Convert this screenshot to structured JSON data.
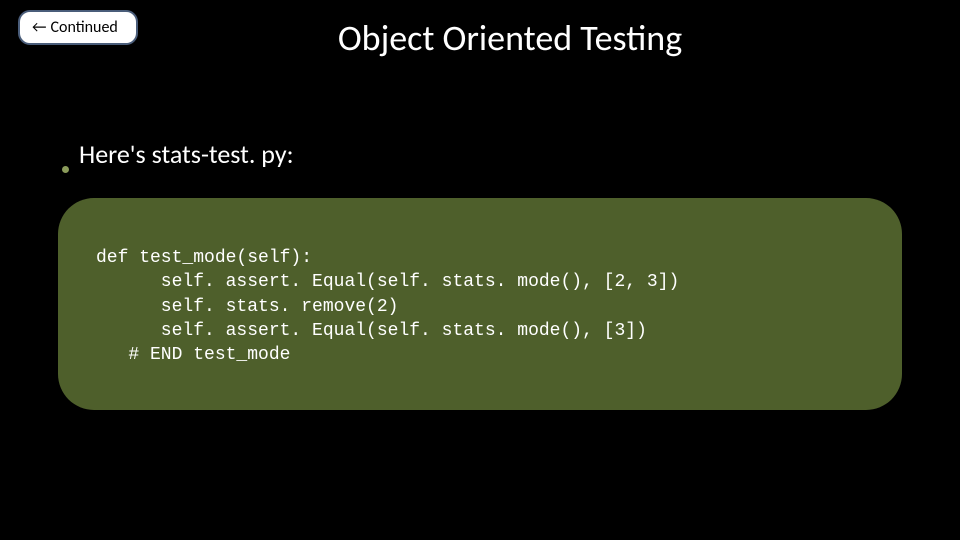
{
  "badge": {
    "arrow": "←",
    "label": "Continued"
  },
  "title": "Object Oriented Testing",
  "bullet": {
    "text": "Here's stats-test. py:"
  },
  "code": {
    "line1": "def test_mode(self):",
    "line2": "      self. assert. Equal(self. stats. mode(), [2, 3])",
    "line3": "      self. stats. remove(2)",
    "line4": "      self. assert. Equal(self. stats. mode(), [3])",
    "line5": "   # END test_mode"
  }
}
